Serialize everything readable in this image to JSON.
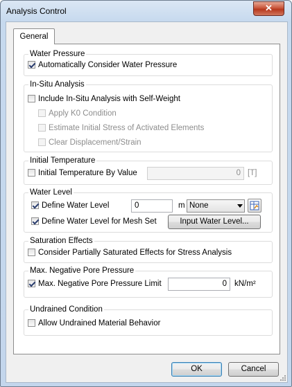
{
  "window": {
    "title": "Analysis Control",
    "close_symbol": "✕"
  },
  "tabs": [
    {
      "label": "General",
      "selected": true
    }
  ],
  "groups": {
    "water_pressure": {
      "title": "Water Pressure",
      "auto_consider": {
        "label": "Automatically Consider Water Pressure",
        "checked": true
      }
    },
    "in_situ": {
      "title": "In-Situ Analysis",
      "include": {
        "label": "Include In-Situ Analysis with Self-Weight",
        "checked": false
      },
      "apply_k0": {
        "label": "Apply K0 Condition",
        "checked": false,
        "enabled": false
      },
      "estimate_stress": {
        "label": "Estimate Initial Stress of Activated Elements",
        "checked": false,
        "enabled": false
      },
      "clear_disp": {
        "label": "Clear Displacement/Strain",
        "checked": false,
        "enabled": false
      }
    },
    "initial_temp": {
      "title": "Initial Temperature",
      "by_value": {
        "label": "Initial Temperature By Value",
        "checked": false
      },
      "value": "0",
      "unit": "[T]"
    },
    "water_level": {
      "title": "Water Level",
      "define": {
        "label": "Define Water Level",
        "checked": true
      },
      "value": "0",
      "unit": "m",
      "function": "None",
      "mesh_set": {
        "label": "Define Water Level for Mesh Set",
        "checked": true
      },
      "input_button": "Input Water Level..."
    },
    "saturation": {
      "title": "Saturation Effects",
      "partial": {
        "label": "Consider Partially Saturated Effects for Stress Analysis",
        "checked": false
      }
    },
    "neg_pore": {
      "title": "Max. Negative Pore Pressure",
      "limit": {
        "label": "Max. Negative Pore Pressure Limit",
        "checked": true
      },
      "value": "0",
      "unit": "kN/m²"
    },
    "undrained": {
      "title": "Undrained Condition",
      "allow": {
        "label": "Allow Undrained Material Behavior",
        "checked": false
      }
    }
  },
  "footer": {
    "ok_label": "OK",
    "cancel_label": "Cancel"
  }
}
